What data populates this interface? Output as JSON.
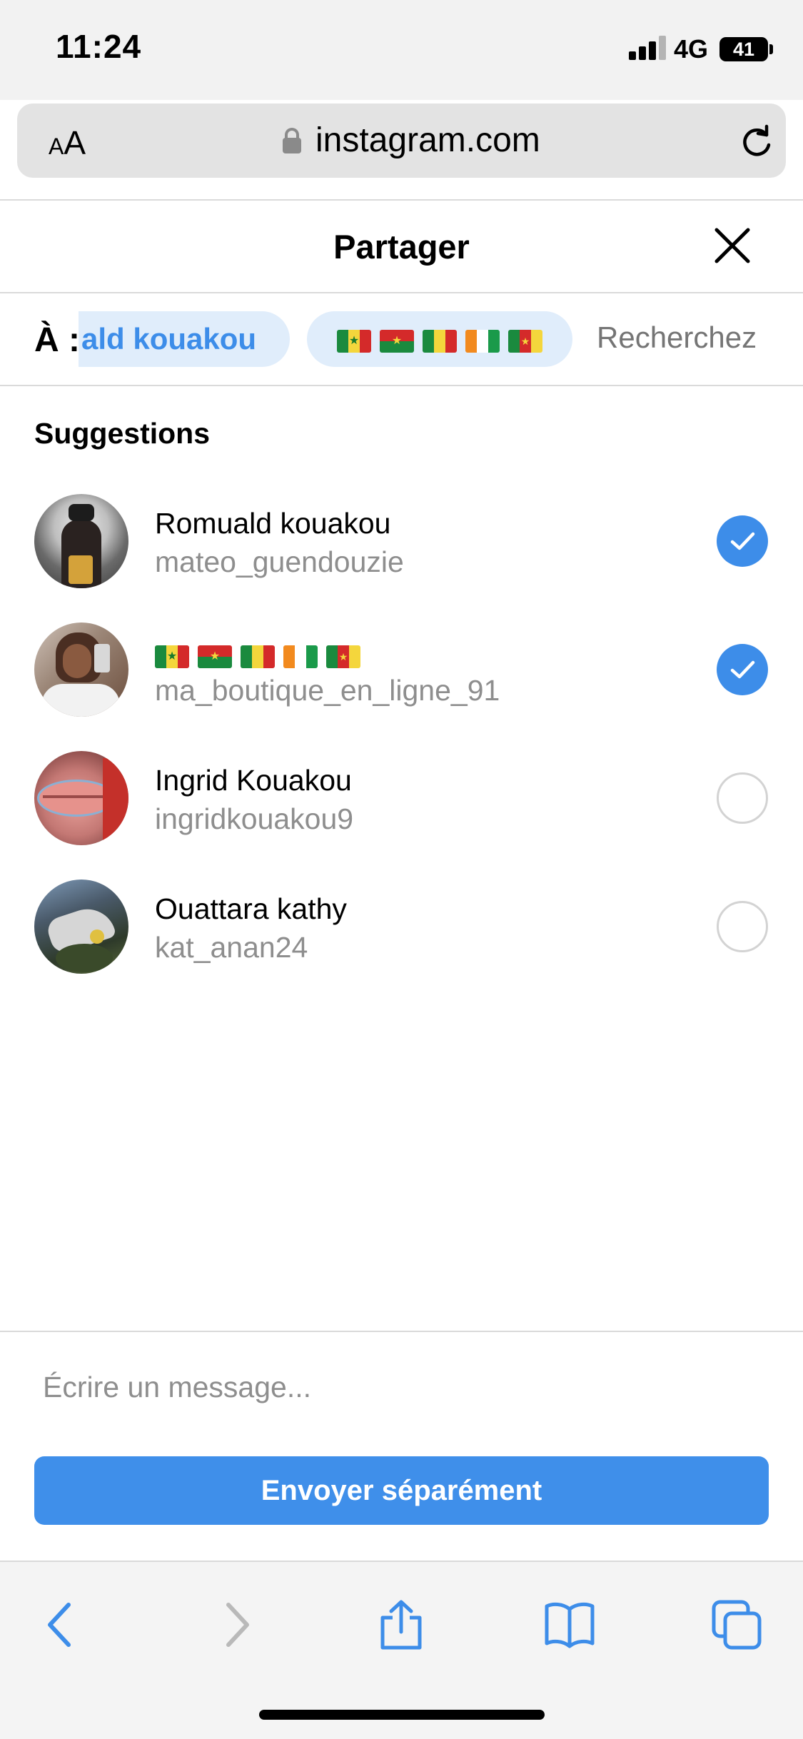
{
  "status_bar": {
    "time": "11:24",
    "network": "4G",
    "battery": "41"
  },
  "browser": {
    "text_size_label_small": "A",
    "text_size_label_large": "A",
    "url": "instagram.com"
  },
  "share_sheet": {
    "title": "Partager",
    "to_label": "À :",
    "chips": [
      {
        "label": "ald kouakou"
      },
      {
        "flags": [
          "senegal-flag",
          "burkina-faso-flag",
          "mali-flag",
          "ivory-coast-flag",
          "cameroon-flag"
        ]
      }
    ],
    "search_placeholder": "Recherchez",
    "suggestions_title": "Suggestions",
    "contacts": [
      {
        "name": "Romuald kouakou",
        "handle": "mateo_guendouzie",
        "selected": true
      },
      {
        "name_flags": [
          "senegal-flag",
          "burkina-faso-flag",
          "mali-flag",
          "ivory-coast-flag",
          "cameroon-flag"
        ],
        "handle": "ma_boutique_en_ligne_91",
        "selected": true
      },
      {
        "name": "Ingrid Kouakou",
        "handle": "ingridkouakou9",
        "selected": false
      },
      {
        "name": "Ouattara kathy",
        "handle": "kat_anan24",
        "selected": false
      }
    ],
    "message_placeholder": "Écrire un message...",
    "send_label": "Envoyer séparément"
  },
  "colors": {
    "accent": "#3d8de9",
    "chip_bg": "#e0edfb",
    "muted_text": "#8e8e8e"
  },
  "toolbar": {
    "icons": [
      "back-icon",
      "forward-icon",
      "share-icon",
      "bookmarks-icon",
      "tabs-icon"
    ]
  }
}
